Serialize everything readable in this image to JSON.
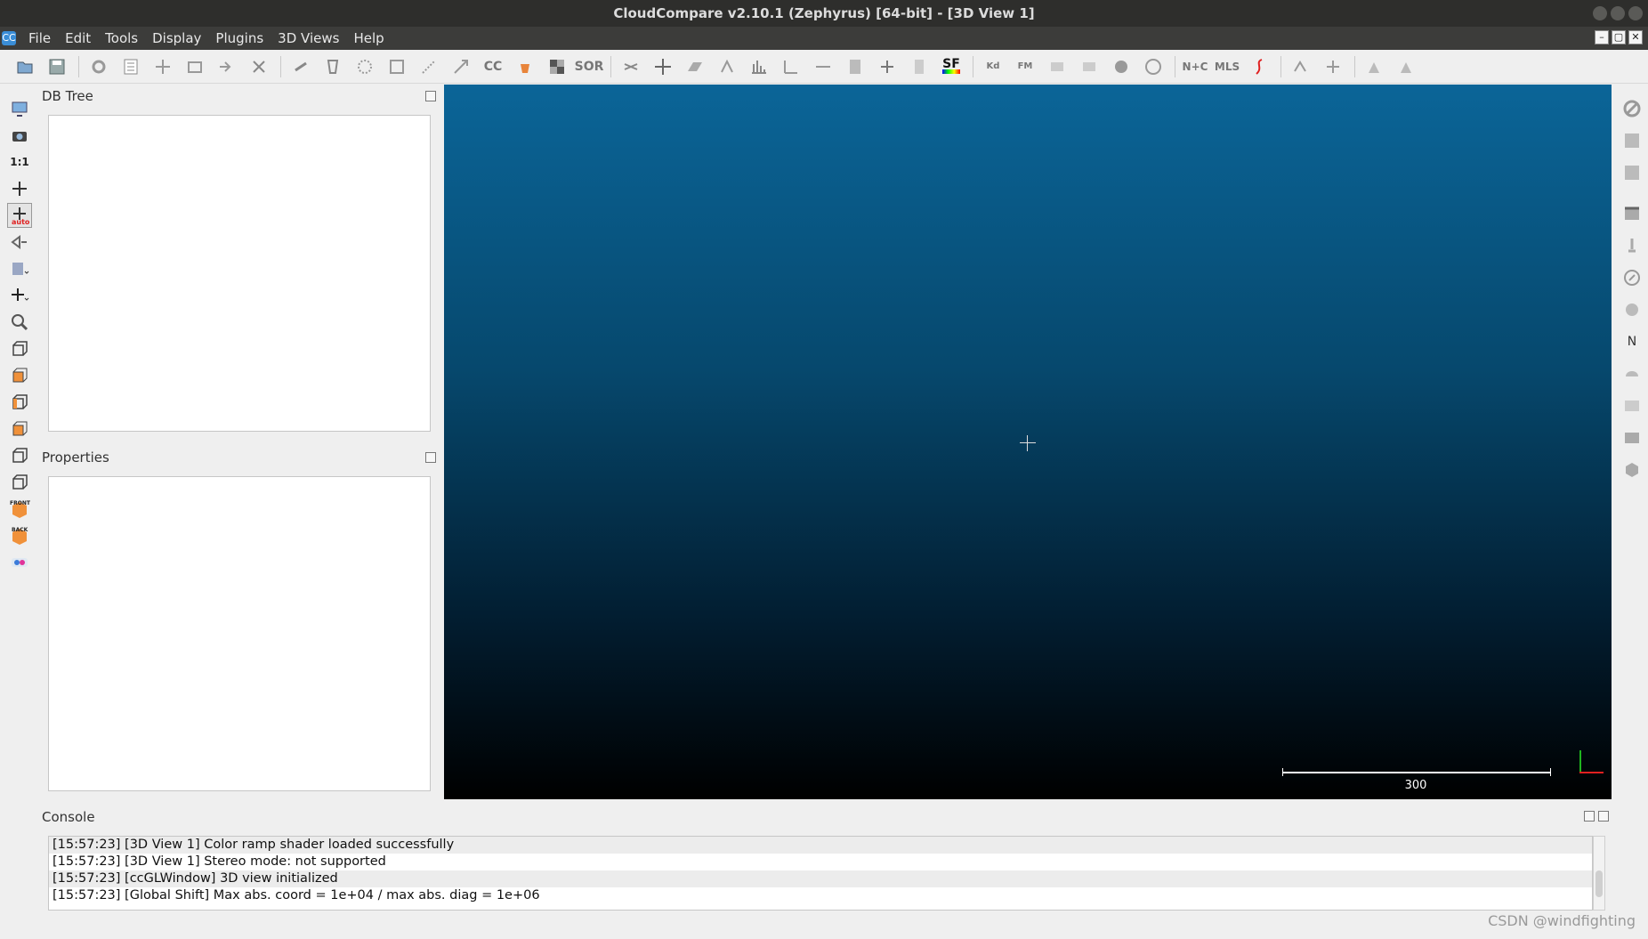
{
  "window": {
    "title": "CloudCompare v2.10.1 (Zephyrus) [64-bit] - [3D View 1]",
    "app_icon_text": "CC"
  },
  "menu": [
    "File",
    "Edit",
    "Tools",
    "Display",
    "Plugins",
    "3D Views",
    "Help"
  ],
  "toolbar": {
    "sf_label": "SF",
    "sor_label": "SOR",
    "cc_label": "CC",
    "kd_label": "Kd",
    "fm_label": "FM",
    "nc_label": "N+C",
    "mls_label": "MLS"
  },
  "left_toolbar": {
    "ratio_label": "1:1",
    "auto_label": "auto",
    "front_label": "FRONT",
    "back_label": "BACK"
  },
  "right_toolbar": {
    "north_label": "N"
  },
  "db_tree": {
    "title": "DB Tree"
  },
  "properties": {
    "title": "Properties"
  },
  "view3d": {
    "scale_value": "300"
  },
  "console": {
    "title": "Console",
    "lines": [
      "[15:57:23] [3D View 1] Color ramp shader loaded successfully",
      "[15:57:23] [3D View 1] Stereo mode: not supported",
      "[15:57:23] [ccGLWindow] 3D view initialized",
      "[15:57:23] [Global Shift] Max abs. coord = 1e+04 / max abs. diag = 1e+06"
    ]
  },
  "watermark": "CSDN @windfighting",
  "colors": {
    "view_top": "#0b6598",
    "view_bottom": "#000000",
    "titlebar": "#2e2e2c",
    "menubar": "#3c3c3a"
  }
}
